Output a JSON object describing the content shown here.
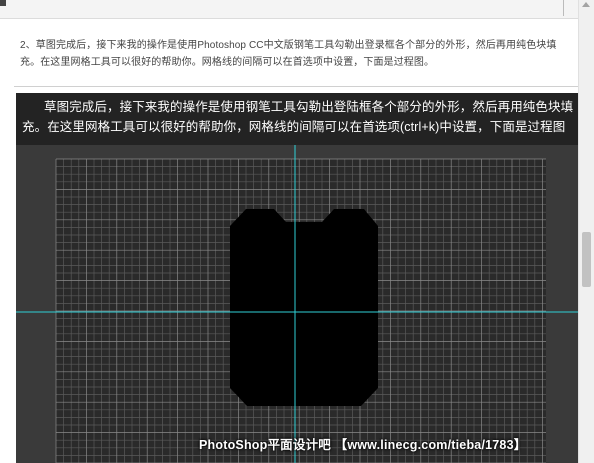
{
  "article": {
    "paragraph": "2、草图完成后，接下来我的操作是使用Photoshop CC中文版钢笔工具勾勒出登录框各个部分的外形，然后再用纯色块填充。在这里网格工具可以很好的帮助你。网格线的间隔可以在首选项中设置，下面是过程图。"
  },
  "screenshot": {
    "caption": "草图完成后，接下来我的操作是使用钢笔工具勾勒出登陆框各个部分的外形，然后再用纯色块填充。在这里网格工具可以很好的帮助你，网格线的间隔可以在首选项(ctrl+k)中设置，下面是过程图",
    "watermark": "PhotoShop平面设计吧 【www.linecg.com/tieba/1783】",
    "colors": {
      "background": "#232323",
      "canvas": "#3a3a3a",
      "grid_fine": "#5a5a5a",
      "grid_major": "#8a8a8a",
      "guide": "#2fd0d6",
      "shape": "#000000"
    }
  }
}
